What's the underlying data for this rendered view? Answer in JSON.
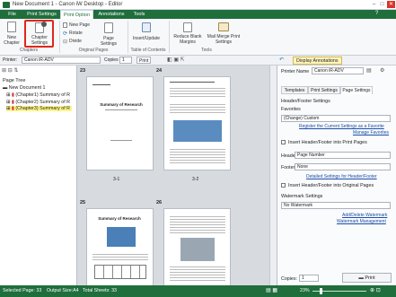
{
  "window": {
    "title": "New Document 1 - Canon iW Desktop - Editor",
    "minimize": "–",
    "maximize": "□",
    "close": "✕"
  },
  "tabs": [
    "File",
    "Print Settings",
    "Print Option",
    "Annotations",
    "Tools"
  ],
  "ribbon": {
    "new_chapter": "New\nChapter",
    "chapter_settings": "Chapter\nSettings",
    "group_chapters": "Chapters",
    "new_page": "New Page",
    "rotate": "Rotate",
    "divide": "Divide",
    "page_settings": "Page\nSettings",
    "group_original": "Original Pages",
    "insert_update": "Insert/Update",
    "group_toc": "Table of Contents",
    "reduce_blank": "Reduce Blank\nMargins",
    "mail_merge": "Mail Merge Print\nSettings",
    "group_tools": "Tools"
  },
  "toolbar": {
    "printer_label": "Printer:",
    "printer_value": "Canon iR-ADV",
    "copies_label": "Copies",
    "copies_value": "1",
    "print": "Print",
    "display_annotations": "Display Annotations"
  },
  "page_tree": {
    "title": "Page Tree",
    "items": [
      "New Document 1",
      "(Chapter1) Summary of R",
      "(Chapter2) Summary of R",
      "(Chapter3) Summary of R"
    ]
  },
  "pages": [
    {
      "number": "23",
      "label": "3-1",
      "heading": "Summary of Research"
    },
    {
      "number": "24",
      "label": "3-2",
      "heading": ""
    },
    {
      "number": "25",
      "label": "",
      "heading": "Summary of Research"
    },
    {
      "number": "26",
      "label": "",
      "heading": ""
    }
  ],
  "right": {
    "printer_name_label": "Printer Name",
    "printer_name_value": "Canon iR-ADV",
    "tabs": [
      "Templates",
      "Print Settings",
      "Page Settings"
    ],
    "hf_title": "Header/Footer Settings",
    "favorites_label": "Favorites",
    "favorites_value": "(Change) Custom",
    "register_link": "Register the Current Settings as a Favorite",
    "manage_link": "Manage Favorites",
    "insert_hf": "Insert Header/Footer into Print Pages",
    "header_label": "Header",
    "header_value": "Page Number",
    "footer_label": "Footer",
    "footer_value": "None",
    "detailed_link": "Detailed Settings for Header/Footer",
    "insert_orig": "Insert Header/Footer into Original Pages",
    "watermark_title": "Watermark Settings",
    "watermark_value": "No Watermark",
    "add_delete_link": "Add/Delete Watermark",
    "wm_manage_link": "Watermark Management",
    "copies_label": "Copies:",
    "copies_value": "1",
    "print_button": "Print"
  },
  "status": {
    "selected": "Selected Page: 33",
    "output_size": "Output Size:A4",
    "total": "Total Sheets: 33",
    "zoom": "23%"
  }
}
